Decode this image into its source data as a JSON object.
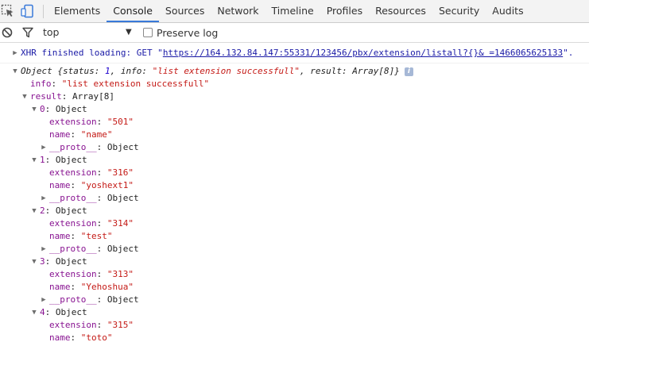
{
  "tabbar": {
    "tabs": [
      {
        "label": "Elements",
        "active": false
      },
      {
        "label": "Console",
        "active": true
      },
      {
        "label": "Sources",
        "active": false
      },
      {
        "label": "Network",
        "active": false
      },
      {
        "label": "Timeline",
        "active": false
      },
      {
        "label": "Profiles",
        "active": false
      },
      {
        "label": "Resources",
        "active": false
      },
      {
        "label": "Security",
        "active": false
      },
      {
        "label": "Audits",
        "active": false
      }
    ],
    "icons": {
      "inspect": "inspect-element-icon",
      "device": "device-mode-icon"
    }
  },
  "toolbar": {
    "clear_icon": "clear-console-icon",
    "filter_icon": "filter-icon",
    "context": "top",
    "preserve_log_label": "Preserve log",
    "preserve_log_checked": false
  },
  "console": {
    "xhr": {
      "prefix": "XHR finished loading: GET \"",
      "url": "https://164.132.84.147:55331/123456/pbx/extension/listall?{}& =1466065625133",
      "suffix": "\"."
    },
    "object": {
      "summary_label": "Object",
      "summary_open": "{status: ",
      "summary_status": "1",
      "summary_mid": ", info: ",
      "summary_info": "\"list extension successfull\"",
      "summary_mid2": ", result: ",
      "summary_result": "Array[8]",
      "summary_close": "}",
      "badge": "i",
      "info_key": "info",
      "info_value": "\"list extension successfull\"",
      "result_key": "result",
      "result_type": "Array[8]",
      "items": [
        {
          "index": "0",
          "type": "Object",
          "ext_key": "extension",
          "extension": "\"501\"",
          "name_key": "name",
          "name": "\"name\"",
          "proto_key": "__proto__",
          "proto": "Object"
        },
        {
          "index": "1",
          "type": "Object",
          "ext_key": "extension",
          "extension": "\"316\"",
          "name_key": "name",
          "name": "\"yoshext1\"",
          "proto_key": "__proto__",
          "proto": "Object"
        },
        {
          "index": "2",
          "type": "Object",
          "ext_key": "extension",
          "extension": "\"314\"",
          "name_key": "name",
          "name": "\"test\"",
          "proto_key": "__proto__",
          "proto": "Object"
        },
        {
          "index": "3",
          "type": "Object",
          "ext_key": "extension",
          "extension": "\"313\"",
          "name_key": "name",
          "name": "\"Yehoshua\"",
          "proto_key": "__proto__",
          "proto": "Object"
        },
        {
          "index": "4",
          "type": "Object",
          "ext_key": "extension",
          "extension": "\"315\"",
          "name_key": "name",
          "name": "\"toto\""
        }
      ]
    }
  },
  "colors": {
    "accent": "#3879d9",
    "key": "#881391",
    "string": "#c41a16",
    "number": "#1c00cf",
    "link": "#1a1aa6"
  }
}
